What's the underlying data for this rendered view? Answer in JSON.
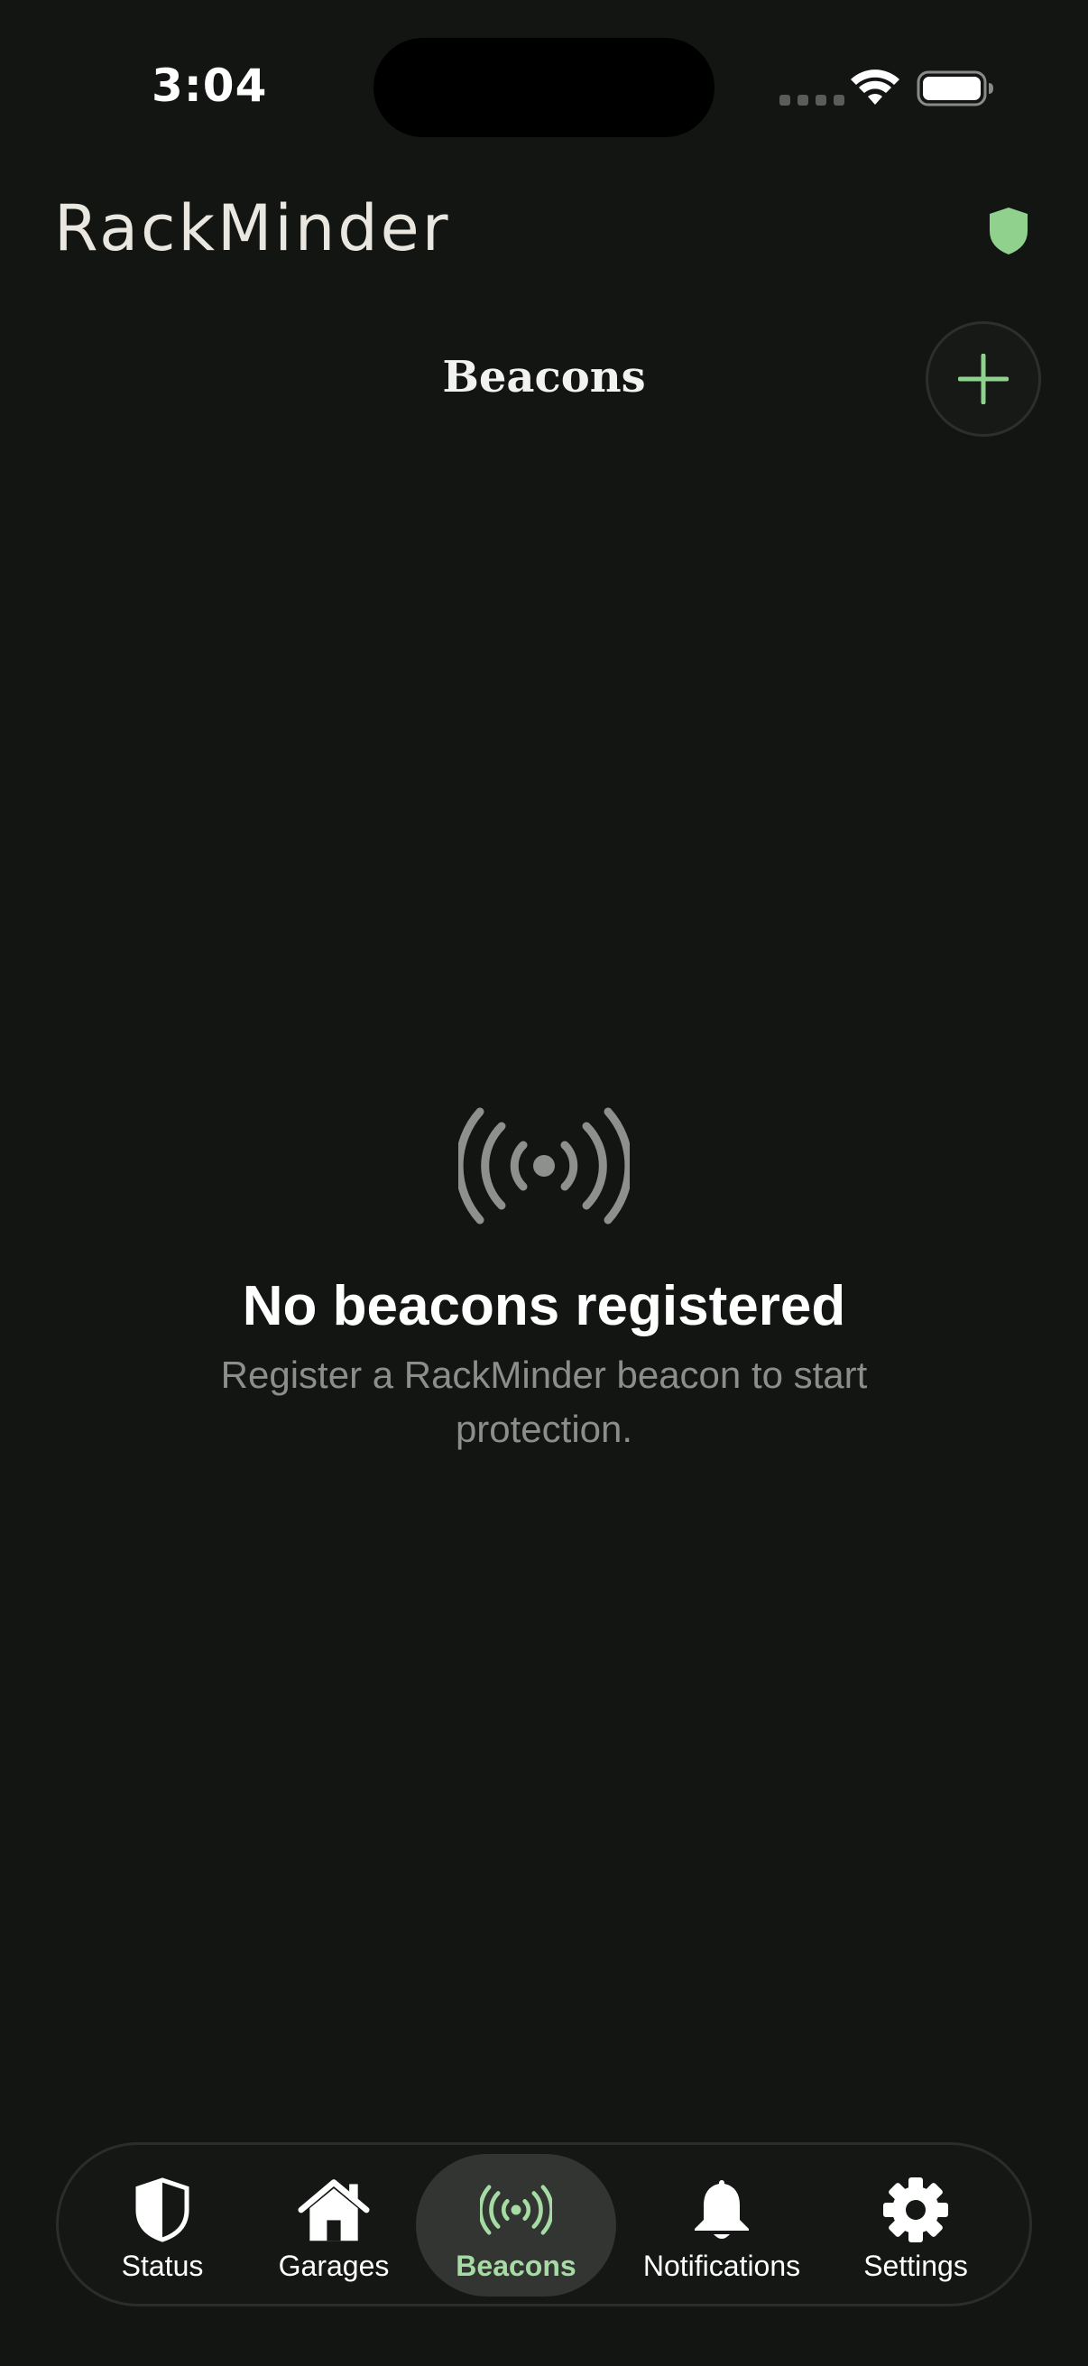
{
  "status_bar": {
    "time": "3:04"
  },
  "header": {
    "app_name": "RackMinder",
    "status_icon": "shield-icon",
    "accent_color": "#8fd18d"
  },
  "page": {
    "title": "Beacons",
    "add_button_icon": "plus-icon"
  },
  "empty_state": {
    "icon": "beacon-broadcast-icon",
    "title": "No beacons registered",
    "subtitle": "Register a RackMinder beacon to start protection."
  },
  "tab_bar": {
    "active_tab": "Beacons",
    "tabs": [
      {
        "label": "Status",
        "icon": "shield-icon"
      },
      {
        "label": "Garages",
        "icon": "house-icon"
      },
      {
        "label": "Beacons",
        "icon": "beacon-broadcast-icon"
      },
      {
        "label": "Notifications",
        "icon": "bell-icon"
      },
      {
        "label": "Settings",
        "icon": "gear-icon"
      }
    ]
  }
}
